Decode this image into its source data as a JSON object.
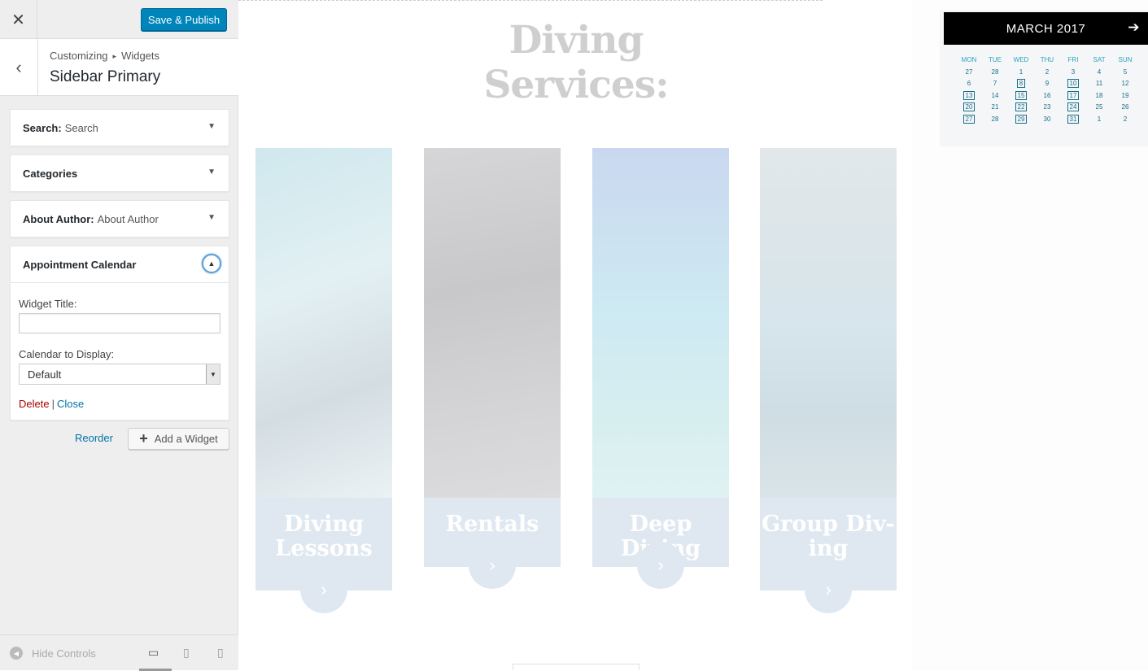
{
  "sidebar": {
    "close_icon": "close-icon",
    "save_label": "Save & Publish",
    "breadcrumb": {
      "root": "Customizing",
      "section": "Widgets"
    },
    "panel_title": "Sidebar Primary",
    "widgets": [
      {
        "type": "Search:",
        "title": "Search"
      },
      {
        "type": "Categories",
        "title": ""
      },
      {
        "type": "About Author:",
        "title": "About Author"
      },
      {
        "type": "Appointment Calendar",
        "title": ""
      }
    ],
    "form": {
      "widget_title_label": "Widget Title:",
      "widget_title_value": "",
      "calendar_label": "Calendar to Display:",
      "calendar_value": "Default",
      "delete_label": "Delete",
      "separator": "|",
      "close_label": "Close"
    },
    "reorder_label": "Reorder",
    "add_widget_label": "Add a Widget",
    "hide_controls_label": "Hide Controls"
  },
  "preview": {
    "heading": "Diving Services:",
    "cards": [
      {
        "label": "Diving Lessons"
      },
      {
        "label": "Rentals"
      },
      {
        "label": "Deep Diving"
      },
      {
        "label": "Group Div-ing"
      }
    ]
  },
  "calendar": {
    "month_label": "MARCH 2017",
    "weekdays": [
      "MON",
      "TUE",
      "WED",
      "THU",
      "FRI",
      "SAT",
      "SUN"
    ],
    "weeks": [
      [
        "27",
        "28",
        "1",
        "2",
        "3",
        "4",
        "5"
      ],
      [
        "6",
        "7",
        "8",
        "9",
        "10",
        "11",
        "12"
      ],
      [
        "13",
        "14",
        "15",
        "16",
        "17",
        "18",
        "19"
      ],
      [
        "20",
        "21",
        "22",
        "23",
        "24",
        "25",
        "26"
      ],
      [
        "27",
        "28",
        "29",
        "30",
        "31",
        "1",
        "2"
      ]
    ],
    "available_days": [
      "8",
      "10",
      "13",
      "15",
      "17",
      "20",
      "22",
      "24",
      "27",
      "29",
      "31"
    ]
  },
  "colors": {
    "accent": "#0085ba",
    "link": "#0073aa",
    "delete": "#aa0000"
  }
}
